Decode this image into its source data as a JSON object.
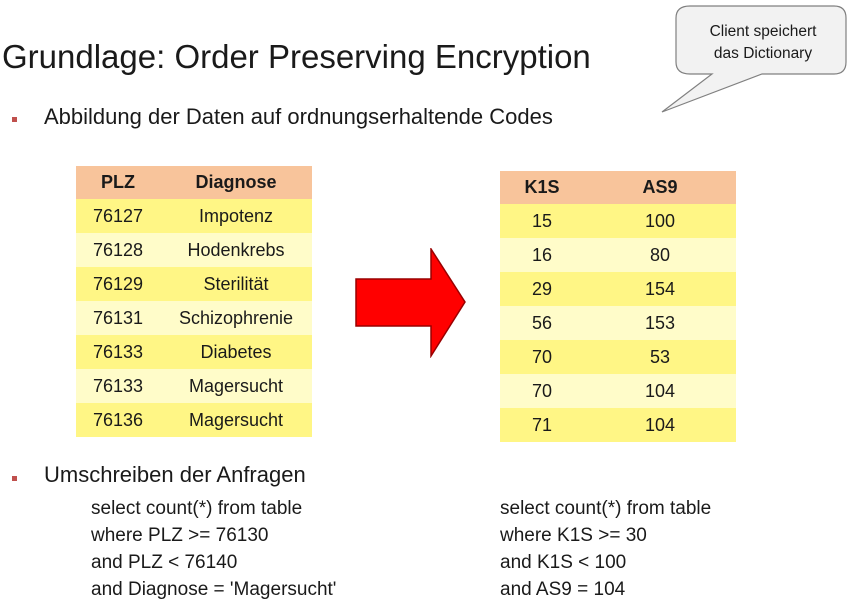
{
  "title": "Grundlage: Order Preserving Encryption",
  "callout": {
    "line1": "Client speichert",
    "line2": "das Dictionary"
  },
  "bullets": [
    "Abbildung der Daten auf ordnungserhaltende Codes",
    "Umschreiben der Anfragen"
  ],
  "left_table": {
    "headers": [
      "PLZ",
      "Diagnose"
    ],
    "rows": [
      [
        "76127",
        "Impotenz"
      ],
      [
        "76128",
        "Hodenkrebs"
      ],
      [
        "76129",
        "Sterilität"
      ],
      [
        "76131",
        "Schizophrenie"
      ],
      [
        "76133",
        "Diabetes"
      ],
      [
        "76133",
        "Magersucht"
      ],
      [
        "76136",
        "Magersucht"
      ]
    ]
  },
  "right_table": {
    "headers": [
      "K1S",
      "AS9"
    ],
    "rows": [
      [
        "15",
        "100"
      ],
      [
        "16",
        "80"
      ],
      [
        "29",
        "154"
      ],
      [
        "56",
        "153"
      ],
      [
        "70",
        "53"
      ],
      [
        "70",
        "104"
      ],
      [
        "71",
        "104"
      ]
    ]
  },
  "query_left": [
    "select count(*) from table",
    "where PLZ >= 76130",
    "and PLZ < 76140",
    "and Diagnose = 'Magersucht'"
  ],
  "query_right": [
    "select count(*) from table",
    "where K1S >= 30",
    "and K1S < 100",
    "and AS9 = 104"
  ],
  "colors": {
    "header_fill": "#f8c49b",
    "row_fill_a": "#fff685",
    "row_fill_b": "#fffcc9",
    "arrow_fill": "#ff0000",
    "bullet": "#c0504d"
  }
}
